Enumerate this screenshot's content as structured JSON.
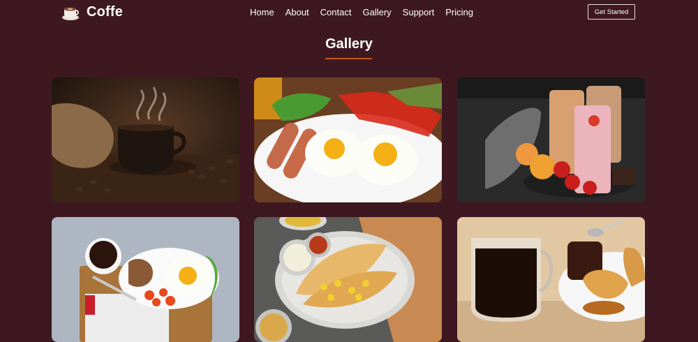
{
  "brand": {
    "name": "Coffe",
    "logo_icon": "coffee-cup-logo-icon"
  },
  "nav": {
    "links": [
      {
        "label": "Home"
      },
      {
        "label": "About"
      },
      {
        "label": "Contact"
      },
      {
        "label": "Gallery"
      },
      {
        "label": "Support"
      },
      {
        "label": "Pricing"
      }
    ],
    "cta_label": "Get Started"
  },
  "gallery": {
    "title": "Gallery",
    "images": [
      {
        "subject": "coffee-cup-with-beans"
      },
      {
        "subject": "fried-eggs-sausages-breakfast"
      },
      {
        "subject": "smoothies-with-fruit"
      },
      {
        "subject": "breakfast-tray-egg-toast"
      },
      {
        "subject": "dosa-with-chutney"
      },
      {
        "subject": "coffee-glass-and-croissant"
      }
    ]
  },
  "colors": {
    "background": "#3e1820",
    "accent": "#c25a1e"
  }
}
